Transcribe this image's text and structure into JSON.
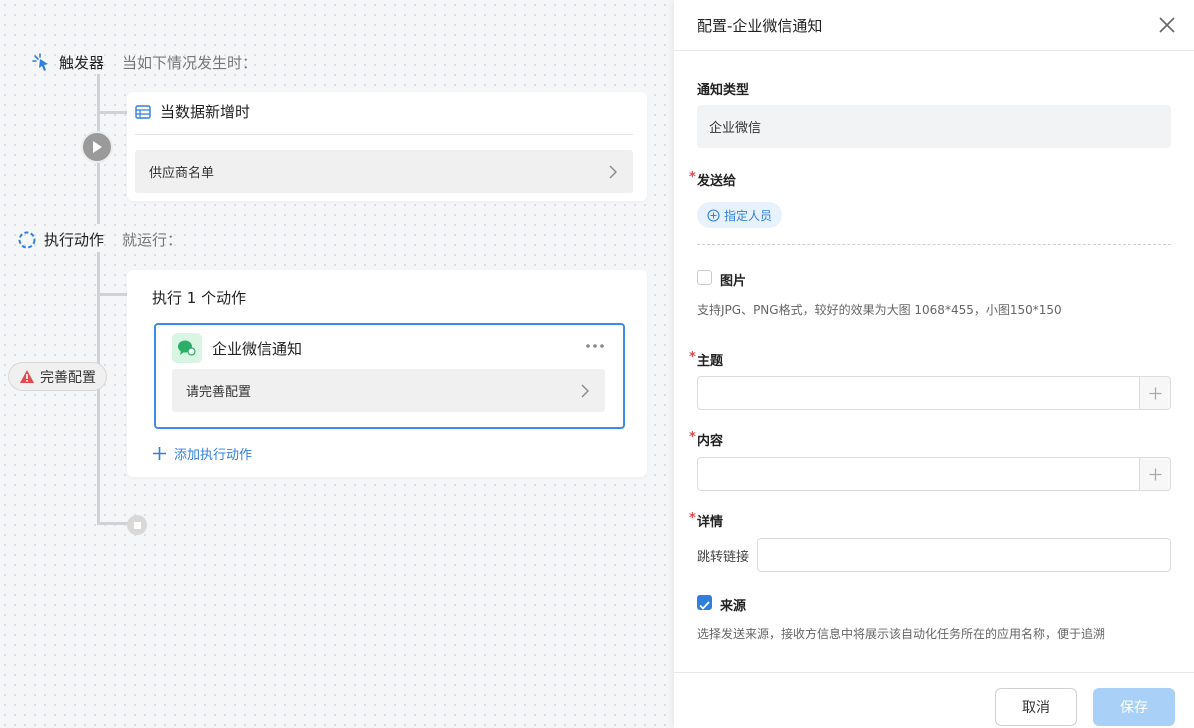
{
  "flow": {
    "trigger": {
      "title": "触发器",
      "subtitle": "当如下情况发生时："
    },
    "trigger_card": {
      "title": "当数据新增时",
      "row_label": "供应商名单"
    },
    "action": {
      "title": "执行动作",
      "subtitle": "就运行："
    },
    "action_card": {
      "title": "执行 1 个动作",
      "item_title": "企业微信通知",
      "item_row": "请完善配置",
      "add_label": "添加执行动作"
    },
    "warning_label": "完善配置"
  },
  "panel": {
    "title": "配置-企业微信通知",
    "notify_type_label": "通知类型",
    "notify_type_value": "企业微信",
    "send_to_label": "发送给",
    "assign_label": "指定人员",
    "image_label": "图片",
    "image_hint": "支持JPG、PNG格式，较好的效果为大图 1068*455，小图150*150",
    "subject_label": "主题",
    "content_label": "内容",
    "detail_label": "详情",
    "jump_link_label": "跳转链接",
    "source_label": "来源",
    "source_hint": "选择发送来源，接收方信息中将展示该自动化任务所在的应用名称，便于追溯",
    "required_mark": "*",
    "cancel_label": "取消",
    "save_label": "保存"
  },
  "colors": {
    "accent": "#2f7fdb",
    "required": "#e5484d",
    "warning": "#e5484d",
    "wechat": "#2bae67"
  }
}
